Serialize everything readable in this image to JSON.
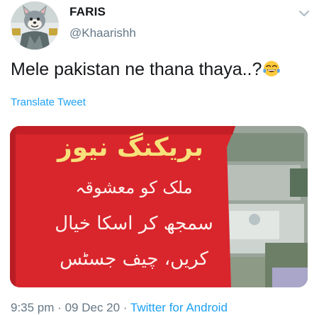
{
  "author": {
    "display_name": "FARIS",
    "handle": "@Khaarishh",
    "avatar_icon": "cartoon-cat-avatar-icon"
  },
  "menu_icon": "chevron-down-icon",
  "tweet": {
    "text": "Mele pakistan ne thana thaya..?",
    "emoji": "tears-of-joy-emoji",
    "translate_label": "Translate Tweet"
  },
  "media": {
    "banner_text": "بریکنگ نیوز",
    "lines": [
      "ملک کو معشوقہ",
      "سمجھ کر اسکا خیال",
      "کریں، چیف جسٹس"
    ],
    "colors": {
      "banner_yellow": "#f7e17a",
      "panel_red": "#d9252c",
      "text_white": "#fdf2ee"
    }
  },
  "meta": {
    "time": "9:35 pm",
    "separator": "·",
    "date": "09 Dec 20",
    "app": "Twitter for Android"
  },
  "colors": {
    "link_blue": "#1da1f2",
    "secondary_gray": "#657786",
    "text_dark": "#14171a"
  }
}
